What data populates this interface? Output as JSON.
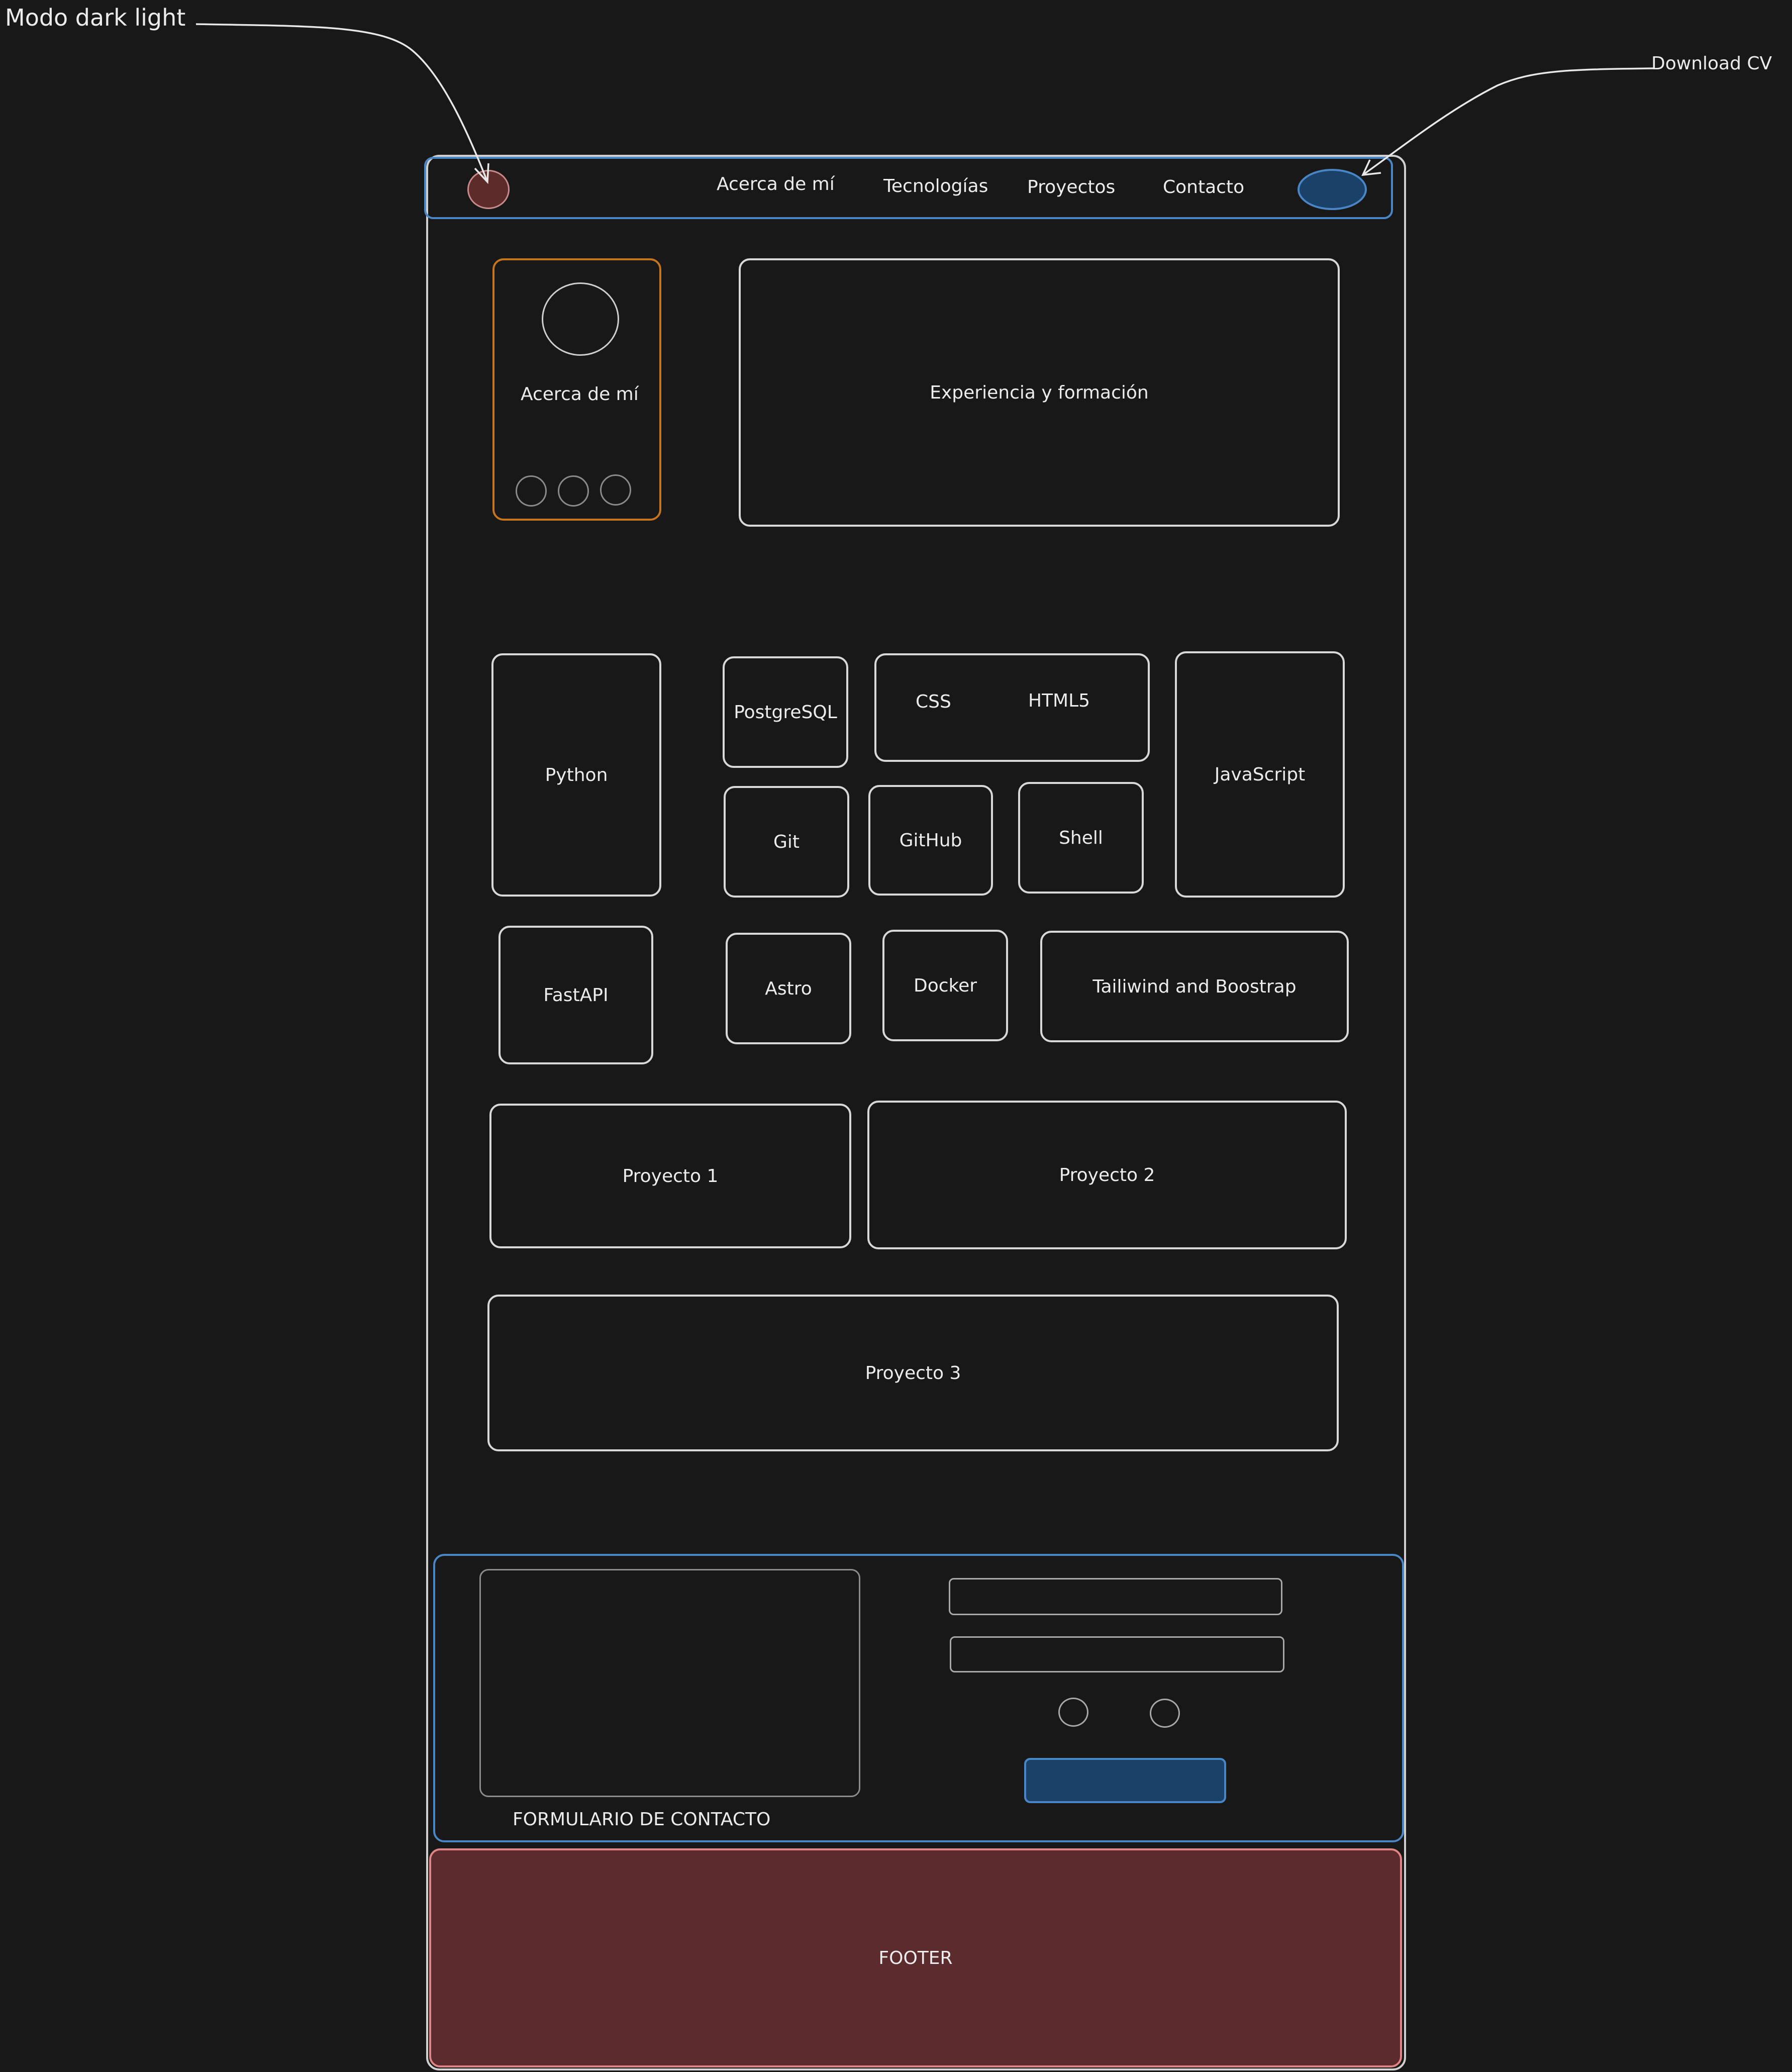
{
  "annotations": {
    "dark_light_mode": "Modo dark light",
    "download_cv": "Download CV"
  },
  "navbar": {
    "items": [
      "Acerca de mí",
      "Tecnologías",
      "Proyectos",
      "Contacto"
    ]
  },
  "about": {
    "card_label": "Acerca de mí",
    "experience_label": "Experiencia y formación"
  },
  "technologies": {
    "python": "Python",
    "postgresql": "PostgreSQL",
    "css": "CSS",
    "html5": "HTML5",
    "javascript": "JavaScript",
    "git": "Git",
    "github": "GitHub",
    "shell": "Shell",
    "fastapi": "FastAPI",
    "astro": "Astro",
    "docker": "Docker",
    "tailwind_bootstrap": "Tailiwind and Boostrap"
  },
  "projects": [
    "Proyecto 1",
    "Proyecto 2",
    "Proyecto 3"
  ],
  "contact": {
    "form_label": "FORMULARIO DE CONTACTO"
  },
  "footer": {
    "label": "FOOTER"
  },
  "colors": {
    "background": "#181818",
    "stroke": "#d8d8d8",
    "blue_outline": "#4a86c5",
    "blue_fill": "#1a4268",
    "orange_outline": "#c5741f",
    "red_fill": "#5c2b2e",
    "red_outline": "#e08585",
    "toggle_fill": "#5e2b2b"
  }
}
